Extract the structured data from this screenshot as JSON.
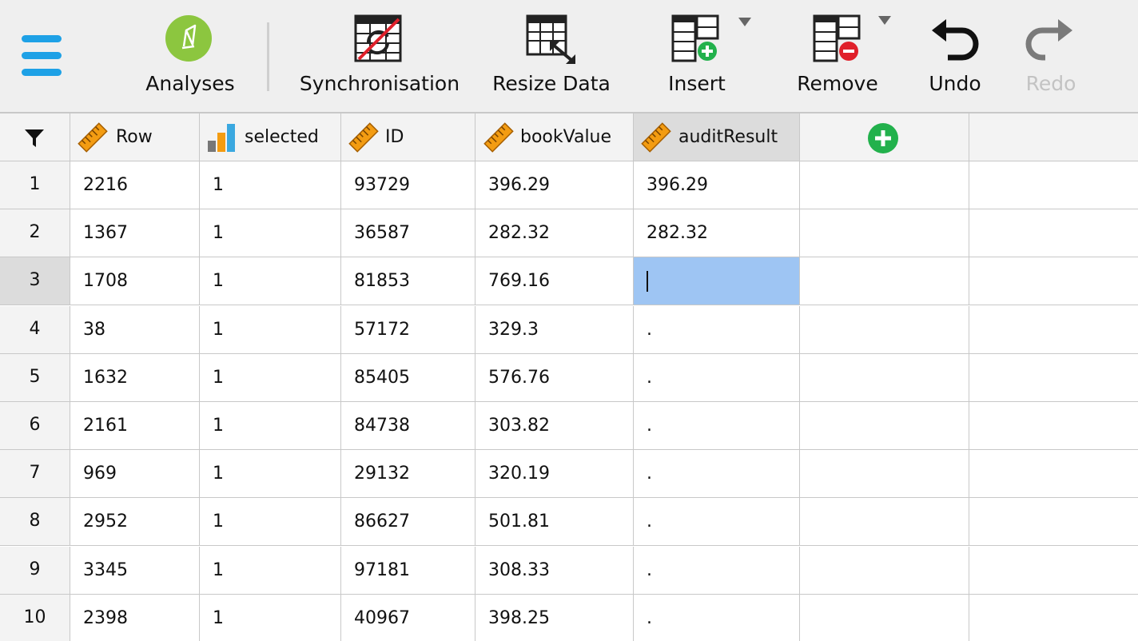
{
  "toolbar": {
    "analyses": "Analyses",
    "synchronisation": "Synchronisation",
    "resize_data": "Resize Data",
    "insert": "Insert",
    "remove": "Remove",
    "undo": "Undo",
    "redo": "Redo"
  },
  "colors": {
    "accent_blue": "#1ea1e6",
    "analyses_green": "#8cc63f",
    "add_green": "#22b14c",
    "remove_red": "#e0202a",
    "scale_orange": "#f39c12",
    "editing_cell": "#9ec5f3"
  },
  "icons": {
    "menu": "hamburger-icon",
    "analyses": "analyses-icon",
    "sync": "sync-disabled-icon",
    "resize": "resize-table-icon",
    "insert": "insert-table-icon",
    "remove": "remove-table-icon",
    "undo": "undo-arrow-icon",
    "redo": "redo-arrow-icon",
    "filter": "filter-funnel-icon",
    "scale": "scale-ruler-icon",
    "ordinal": "ordinal-bars-icon",
    "add_column": "plus-circle-icon"
  },
  "columns": [
    {
      "name": "Row",
      "type": "scale"
    },
    {
      "name": "selected",
      "type": "ordinal"
    },
    {
      "name": "ID",
      "type": "scale"
    },
    {
      "name": "bookValue",
      "type": "scale"
    },
    {
      "name": "auditResult",
      "type": "scale"
    }
  ],
  "rows": [
    {
      "num": "1",
      "cells": [
        "2216",
        "1",
        "93729",
        "396.29",
        "396.29"
      ]
    },
    {
      "num": "2",
      "cells": [
        "1367",
        "1",
        "36587",
        "282.32",
        "282.32"
      ]
    },
    {
      "num": "3",
      "cells": [
        "1708",
        "1",
        "81853",
        "769.16",
        ""
      ]
    },
    {
      "num": "4",
      "cells": [
        "38",
        "1",
        "57172",
        "329.3",
        "."
      ]
    },
    {
      "num": "5",
      "cells": [
        "1632",
        "1",
        "85405",
        "576.76",
        "."
      ]
    },
    {
      "num": "6",
      "cells": [
        "2161",
        "1",
        "84738",
        "303.82",
        "."
      ]
    },
    {
      "num": "7",
      "cells": [
        "969",
        "1",
        "29132",
        "320.19",
        "."
      ]
    },
    {
      "num": "8",
      "cells": [
        "2952",
        "1",
        "86627",
        "501.81",
        "."
      ]
    },
    {
      "num": "9",
      "cells": [
        "3345",
        "1",
        "97181",
        "308.33",
        "."
      ]
    },
    {
      "num": "10",
      "cells": [
        "2398",
        "1",
        "40967",
        "398.25",
        "."
      ]
    }
  ]
}
